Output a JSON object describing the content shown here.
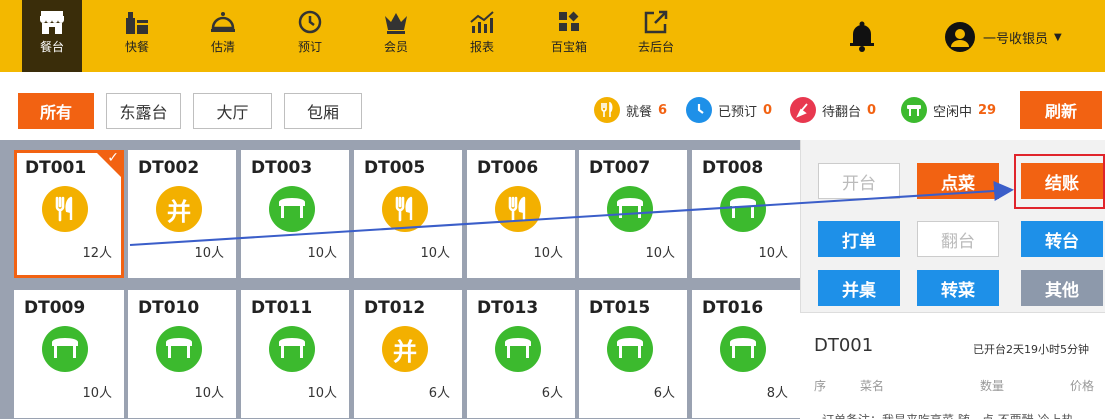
{
  "nav": [
    {
      "label": "餐台",
      "icon": "shop-icon",
      "active": true
    },
    {
      "label": "快餐",
      "icon": "fastfood-icon",
      "active": false
    },
    {
      "label": "估清",
      "icon": "cloche-icon",
      "active": false
    },
    {
      "label": "预订",
      "icon": "clock-icon",
      "active": false
    },
    {
      "label": "会员",
      "icon": "crown-icon",
      "active": false
    },
    {
      "label": "报表",
      "icon": "chart-icon",
      "active": false
    },
    {
      "label": "百宝箱",
      "icon": "toolbox-icon",
      "active": false
    },
    {
      "label": "去后台",
      "icon": "external-link-icon",
      "active": false
    }
  ],
  "user": {
    "name": "一号收银员"
  },
  "filters": [
    "所有",
    "东露台",
    "大厅",
    "包厢"
  ],
  "legend": [
    {
      "label": "就餐",
      "count": "6",
      "color": "#f3b000",
      "count_color": "#f26212"
    },
    {
      "label": "已预订",
      "count": "0",
      "color": "#1e90e8",
      "count_color": "#f26212"
    },
    {
      "label": "待翻台",
      "count": "0",
      "color": "#e8384f",
      "count_color": "#f26212"
    },
    {
      "label": "空闲中",
      "count": "29",
      "color": "#3cba2e",
      "count_color": "#f26212"
    }
  ],
  "refresh_label": "刷新",
  "tables": [
    {
      "name": "DT001",
      "status": "dining",
      "seats": "12人",
      "selected": true
    },
    {
      "name": "DT002",
      "status": "merged",
      "seats": "10人"
    },
    {
      "name": "DT003",
      "status": "free",
      "seats": "10人"
    },
    {
      "name": "DT005",
      "status": "dining",
      "seats": "10人"
    },
    {
      "name": "DT006",
      "status": "dining",
      "seats": "10人"
    },
    {
      "name": "DT007",
      "status": "free",
      "seats": "10人"
    },
    {
      "name": "DT008",
      "status": "free",
      "seats": "10人"
    },
    {
      "name": "DT009",
      "status": "free",
      "seats": "10人"
    },
    {
      "name": "DT010",
      "status": "free",
      "seats": "10人"
    },
    {
      "name": "DT011",
      "status": "free",
      "seats": "10人"
    },
    {
      "name": "DT012",
      "status": "merged",
      "seats": "6人"
    },
    {
      "name": "DT013",
      "status": "free",
      "seats": "6人"
    },
    {
      "name": "DT015",
      "status": "free",
      "seats": "6人"
    },
    {
      "name": "DT016",
      "status": "free",
      "seats": "8人"
    }
  ],
  "merged_glyph": "并",
  "status_colors": {
    "dining": "#f3b000",
    "merged": "#f3b000",
    "free": "#3cba2e"
  },
  "actions": {
    "open": "开台",
    "order": "点菜",
    "checkout": "结账",
    "print": "打单",
    "flip": "翻台",
    "transfer": "转台",
    "merge": "并桌",
    "move_dish": "转菜",
    "other": "其他"
  },
  "order": {
    "table": "DT001",
    "opened": "已开台2天19小时5分钟",
    "col_index": "序",
    "col_name": "菜名",
    "col_qty": "数量",
    "col_price": "价格",
    "note": "订单备注：我是来吃高菜 随一点 不要醋 冷上热"
  }
}
